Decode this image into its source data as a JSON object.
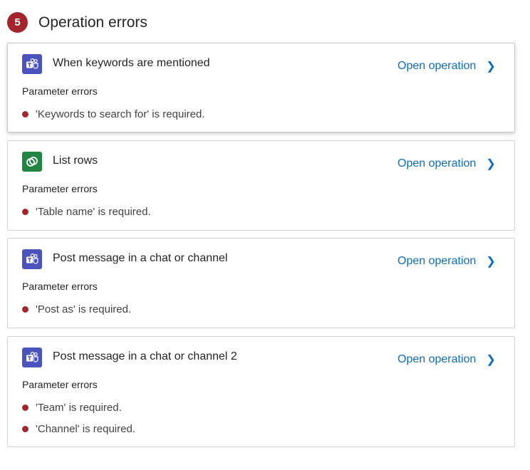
{
  "header": {
    "count": "5",
    "title": "Operation errors"
  },
  "open_label": "Open operation",
  "param_errors_label": "Parameter errors",
  "operations": [
    {
      "title": "When keywords are mentioned",
      "icon": "teams-icon",
      "errors": [
        "'Keywords to search for' is required."
      ]
    },
    {
      "title": "List rows",
      "icon": "dataverse-icon",
      "errors": [
        "'Table name' is required."
      ]
    },
    {
      "title": "Post message in a chat or channel",
      "icon": "teams-icon",
      "errors": [
        "'Post as' is required."
      ]
    },
    {
      "title": "Post message in a chat or channel 2",
      "icon": "teams-icon",
      "errors": [
        "'Team' is required.",
        "'Channel' is required."
      ]
    }
  ],
  "colors": {
    "error": "#a4262c",
    "link": "#0f6cbd",
    "teams": "#4b53bc",
    "dataverse": "#218641"
  }
}
